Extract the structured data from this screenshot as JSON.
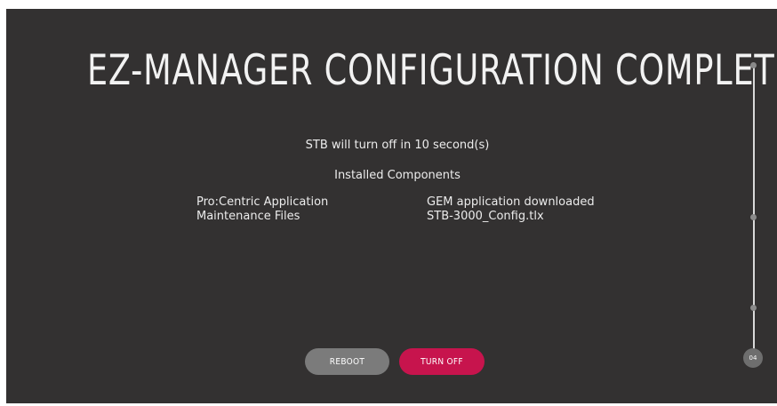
{
  "title": "EZ-MANAGER CONFIGURATION COMPLETE",
  "countdown_text": "STB will turn off in 10 second(s)",
  "installed_heading": "Installed Components",
  "components": [
    {
      "label": "Pro:Centric Application",
      "value": "GEM application downloaded"
    },
    {
      "label": "Maintenance Files",
      "value": "STB-3000_Config.tlx"
    }
  ],
  "buttons": {
    "reboot_label": "REBOOT",
    "turn_off_label": "TURN OFF"
  },
  "stepper": {
    "current_step": "04"
  },
  "colors": {
    "background": "#333131",
    "accent": "#c7144d",
    "secondary_button": "#7b7b7b"
  }
}
